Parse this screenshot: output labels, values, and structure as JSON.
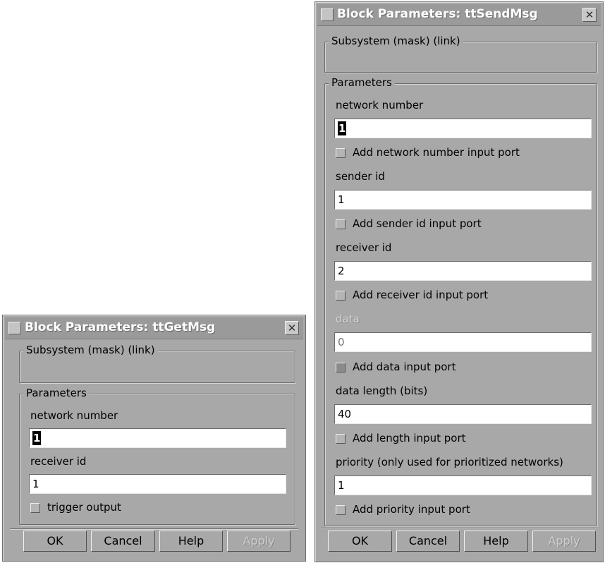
{
  "get_dialog": {
    "title": "Block Parameters: ttGetMsg",
    "close_glyph": "✕",
    "subsystem_label": "Subsystem (mask) (link)",
    "params_label": "Parameters",
    "network_number_label": "network number",
    "network_number_value": "1",
    "receiver_id_label": "receiver id",
    "receiver_id_value": "1",
    "trigger_output_label": "trigger output",
    "buttons": {
      "ok": "OK",
      "cancel": "Cancel",
      "help": "Help",
      "apply": "Apply"
    }
  },
  "send_dialog": {
    "title": "Block Parameters: ttSendMsg",
    "close_glyph": "✕",
    "subsystem_label": "Subsystem (mask) (link)",
    "params_label": "Parameters",
    "network_number_label": "network number",
    "network_number_value": "1",
    "add_network_port_label": "Add network number input port",
    "sender_id_label": "sender id",
    "sender_id_value": "1",
    "add_sender_port_label": "Add sender id input port",
    "receiver_id_label": "receiver id",
    "receiver_id_value": "2",
    "add_receiver_port_label": "Add receiver id input port",
    "data_label": "data",
    "data_value": "0",
    "add_data_port_label": "Add data input port",
    "data_length_label": "data length (bits)",
    "data_length_value": "40",
    "add_length_port_label": "Add length input port",
    "priority_label": "priority (only used for prioritized networks)",
    "priority_value": "1",
    "add_priority_port_label": "Add priority input port",
    "buttons": {
      "ok": "OK",
      "cancel": "Cancel",
      "help": "Help",
      "apply": "Apply"
    }
  }
}
